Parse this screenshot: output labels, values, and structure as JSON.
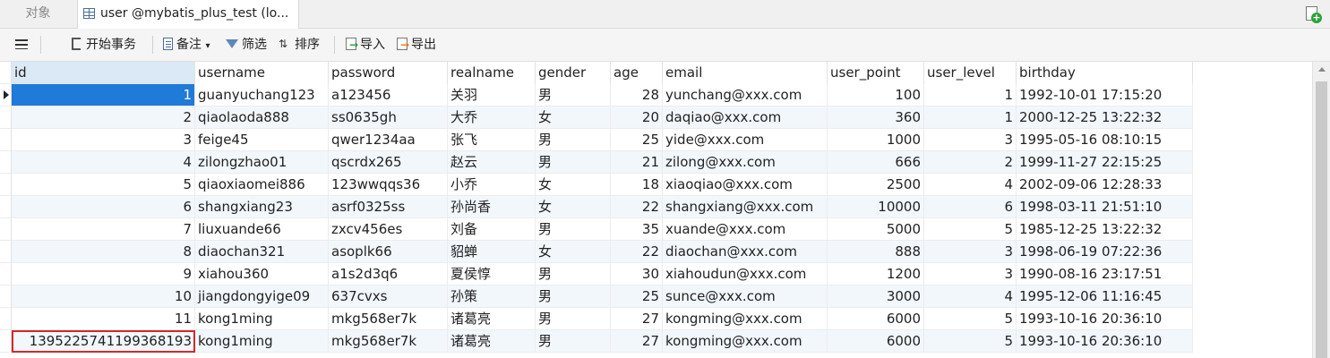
{
  "tabs": {
    "objects": "对象",
    "active": "user @mybatis_plus_test (lo..."
  },
  "toolbar": {
    "begin_transaction": "开始事务",
    "note": "备注",
    "filter": "筛选",
    "sort": "排序",
    "import": "导入",
    "export": "导出"
  },
  "columns": [
    "id",
    "username",
    "password",
    "realname",
    "gender",
    "age",
    "email",
    "user_point",
    "user_level",
    "birthday"
  ],
  "rows": [
    {
      "id": "1",
      "username": "guanyuchang123",
      "password": "a123456",
      "realname": "关羽",
      "gender": "男",
      "age": "28",
      "email": "yunchang@xxx.com",
      "user_point": "100",
      "user_level": "1",
      "birthday": "1992-10-01 17:15:20"
    },
    {
      "id": "2",
      "username": "qiaolaoda888",
      "password": "ss0635gh",
      "realname": "大乔",
      "gender": "女",
      "age": "20",
      "email": "daqiao@xxx.com",
      "user_point": "360",
      "user_level": "1",
      "birthday": "2000-12-25 13:22:32"
    },
    {
      "id": "3",
      "username": "feige45",
      "password": "qwer1234aa",
      "realname": "张飞",
      "gender": "男",
      "age": "25",
      "email": "yide@xxx.com",
      "user_point": "1000",
      "user_level": "3",
      "birthday": "1995-05-16 08:10:15"
    },
    {
      "id": "4",
      "username": "zilongzhao01",
      "password": "qscrdx265",
      "realname": "赵云",
      "gender": "男",
      "age": "21",
      "email": "zilong@xxx.com",
      "user_point": "666",
      "user_level": "2",
      "birthday": "1999-11-27 22:15:25"
    },
    {
      "id": "5",
      "username": "qiaoxiaomei886",
      "password": "123wwqqs36",
      "realname": "小乔",
      "gender": "女",
      "age": "18",
      "email": "xiaoqiao@xxx.com",
      "user_point": "2500",
      "user_level": "4",
      "birthday": "2002-09-06 12:28:33"
    },
    {
      "id": "6",
      "username": "shangxiang23",
      "password": "asrf0325ss",
      "realname": "孙尚香",
      "gender": "女",
      "age": "22",
      "email": "shangxiang@xxx.com",
      "user_point": "10000",
      "user_level": "6",
      "birthday": "1998-03-11 21:51:10"
    },
    {
      "id": "7",
      "username": "liuxuande66",
      "password": "zxcv456es",
      "realname": "刘备",
      "gender": "男",
      "age": "35",
      "email": "xuande@xxx.com",
      "user_point": "5000",
      "user_level": "5",
      "birthday": "1985-12-25 13:22:32"
    },
    {
      "id": "8",
      "username": "diaochan321",
      "password": "asoplk66",
      "realname": "貂蝉",
      "gender": "女",
      "age": "22",
      "email": "diaochan@xxx.com",
      "user_point": "888",
      "user_level": "3",
      "birthday": "1998-06-19 07:22:36"
    },
    {
      "id": "9",
      "username": "xiahou360",
      "password": "a1s2d3q6",
      "realname": "夏侯惇",
      "gender": "男",
      "age": "30",
      "email": "xiahoudun@xxx.com",
      "user_point": "1200",
      "user_level": "3",
      "birthday": "1990-08-16 23:17:51"
    },
    {
      "id": "10",
      "username": "jiangdongyige09",
      "password": "637cvxs",
      "realname": "孙策",
      "gender": "男",
      "age": "25",
      "email": "sunce@xxx.com",
      "user_point": "3000",
      "user_level": "4",
      "birthday": "1995-12-06 11:16:45"
    },
    {
      "id": "11",
      "username": "kong1ming",
      "password": "mkg568er7k",
      "realname": "诸葛亮",
      "gender": "男",
      "age": "27",
      "email": "kongming@xxx.com",
      "user_point": "6000",
      "user_level": "5",
      "birthday": "1993-10-16 20:36:10"
    },
    {
      "id": "1395225741199368193",
      "username": "kong1ming",
      "password": "mkg568er7k",
      "realname": "诸葛亮",
      "gender": "男",
      "age": "27",
      "email": "kongming@xxx.com",
      "user_point": "6000",
      "user_level": "5",
      "birthday": "1993-10-16 20:36:10"
    }
  ],
  "selected_row": 0,
  "highlighted_cell": {
    "row": 11,
    "column": "id"
  }
}
